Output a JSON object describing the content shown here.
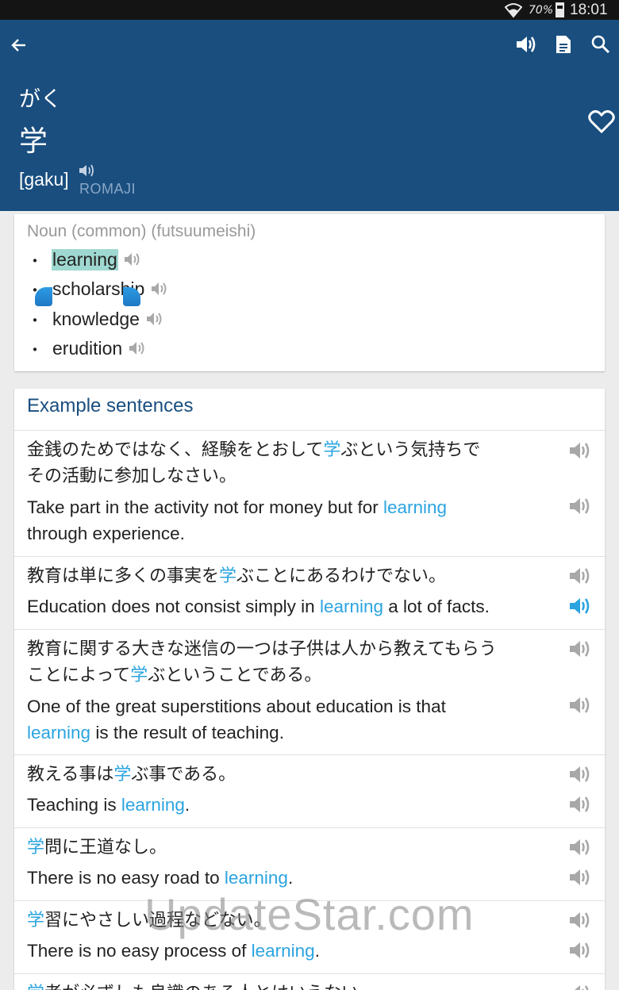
{
  "status_bar": {
    "battery": "70%",
    "time": "18:01"
  },
  "entry": {
    "kana": "がく",
    "kanji": "学",
    "romaji": "[gaku]",
    "romaji_label": "ROMAJI"
  },
  "definitions": {
    "part_of_speech": "Noun (common) (futsuumeishi)",
    "senses": [
      "learning",
      "scholarship",
      "knowledge",
      "erudition"
    ],
    "bullet": "・"
  },
  "examples": {
    "title": "Example sentences",
    "items": [
      {
        "jp": [
          "金銭のためではなく、経験をとおして",
          "学",
          "ぶという気持ちで",
          "その活動に参加しなさい。"
        ],
        "en": [
          "Take part in the activity not for money but for ",
          "learning",
          "",
          "through experience."
        ]
      },
      {
        "jp": [
          "教育は単に多くの事実を",
          "学",
          "ぶことにあるわけでない。"
        ],
        "en": [
          "Education does not consist simply in ",
          "learning",
          " a lot of facts."
        ]
      },
      {
        "jp": [
          "教育に関する大きな迷信の一つは子供は人から教えてもらう",
          "ことによって",
          "学",
          "ぶということである。"
        ],
        "en": [
          "One of the great superstitions about education is that",
          "learning",
          " is the result of teaching."
        ]
      },
      {
        "jp": [
          "教える事は",
          "学",
          "ぶ事である。"
        ],
        "en": [
          "Teaching is ",
          "learning",
          "."
        ]
      },
      {
        "jp": [
          "学",
          "問に王道なし。"
        ],
        "en": [
          "There is no easy road to ",
          "learning",
          "."
        ]
      },
      {
        "jp": [
          "学",
          "習にやさしい過程などない。"
        ],
        "en": [
          "There is no easy process of ",
          "learning",
          "."
        ]
      },
      {
        "jp": [
          "学",
          "者が必ずしも良識のある人とはいえない。"
        ]
      }
    ]
  },
  "watermark": "UpdateStar.com",
  "colors": {
    "header": "#194e7f",
    "highlight": "#2ba4e0",
    "selection": "#9fd8d0"
  }
}
